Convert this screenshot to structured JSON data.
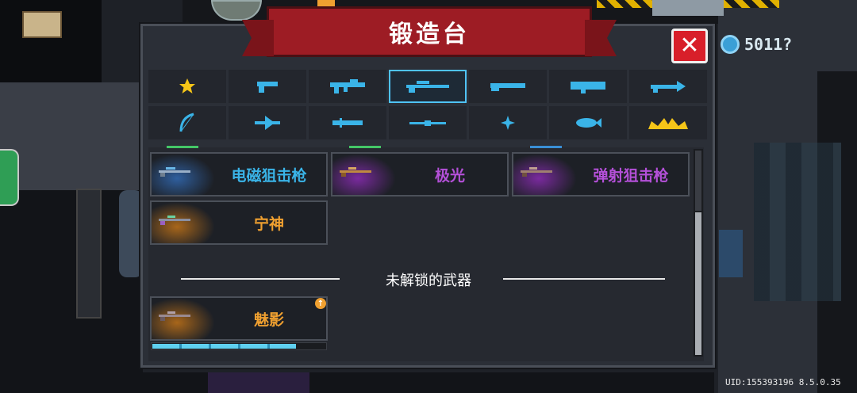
{
  "title": "锻造台",
  "close_label": "✕",
  "currency": {
    "value": "5011?",
    "display": "5011?"
  },
  "categories": [
    {
      "name": "star-icon",
      "color": "#f5c518"
    },
    {
      "name": "pistol-icon",
      "color": "#3ab4e8"
    },
    {
      "name": "rifle-icon",
      "color": "#3ab4e8"
    },
    {
      "name": "sniper-icon",
      "color": "#3ab4e8",
      "selected": true
    },
    {
      "name": "shotgun-icon",
      "color": "#3ab4e8"
    },
    {
      "name": "launcher-icon",
      "color": "#3ab4e8"
    },
    {
      "name": "staff-icon",
      "color": "#3ab4e8"
    },
    {
      "name": "bow-icon",
      "color": "#3ab4e8"
    },
    {
      "name": "crossbow-icon",
      "color": "#3ab4e8"
    },
    {
      "name": "blade-icon",
      "color": "#3ab4e8"
    },
    {
      "name": "spear-icon",
      "color": "#3ab4e8"
    },
    {
      "name": "shuriken-icon",
      "color": "#3ab4e8"
    },
    {
      "name": "fish-icon",
      "color": "#3ab4e8"
    },
    {
      "name": "crown-icon",
      "color": "#f5c518"
    }
  ],
  "weapons": [
    {
      "name": "电磁狙击枪",
      "color": "#3ab4e8",
      "glow": "#2f5f9e",
      "accent": "#44c767"
    },
    {
      "name": "极光",
      "color": "#b450d8",
      "glow": "#7a2a9e",
      "accent": "#44c767"
    },
    {
      "name": "弹射狙击枪",
      "color": "#b450d8",
      "glow": "#7a2a9e",
      "accent": "#3a8fd6"
    },
    {
      "name": "宁神",
      "color": "#f0a030",
      "glow": "#a8661a",
      "accent": ""
    }
  ],
  "divider_text": "未解锁的武器",
  "locked_weapons": [
    {
      "name": "魅影",
      "color": "#f0a030",
      "glow": "#a8661a",
      "upgrade_badge": "↑",
      "progress": 0.83
    }
  ],
  "uid": "UID:155393196 8.5.0.35"
}
